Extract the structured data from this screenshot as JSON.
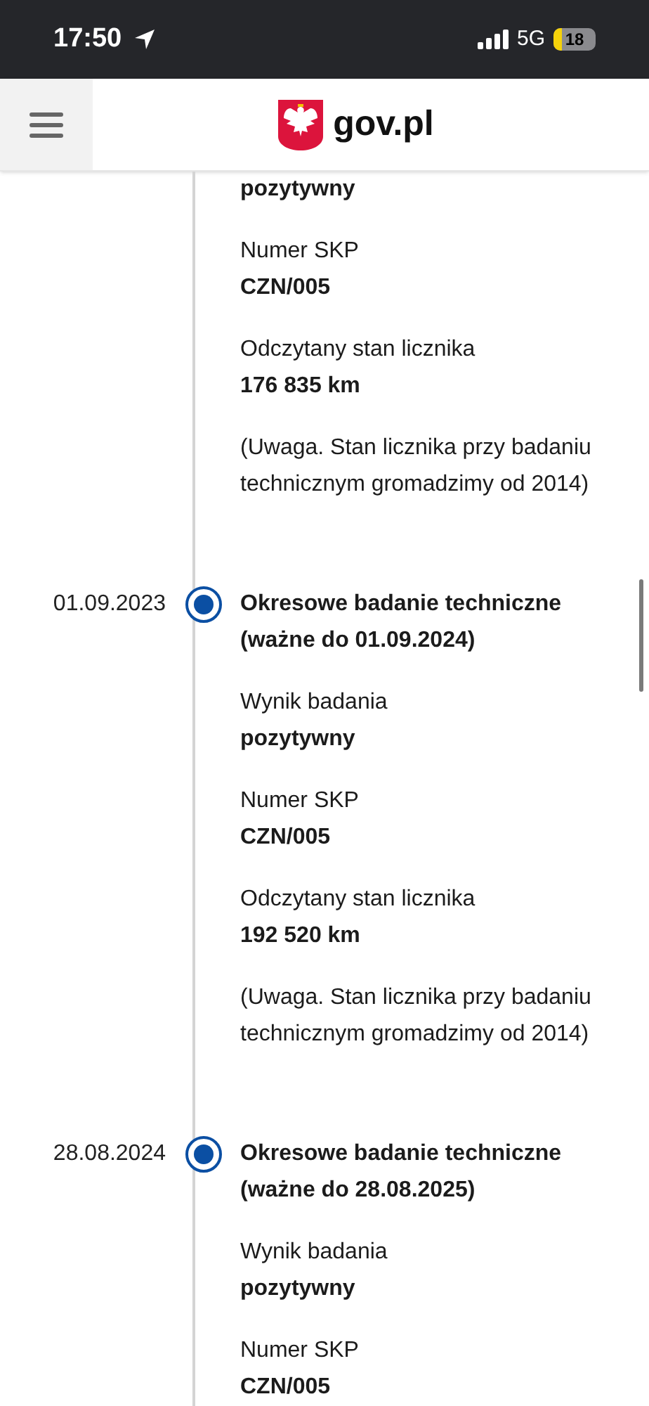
{
  "status_bar": {
    "time": "17:50",
    "network": "5G",
    "battery": "18"
  },
  "header": {
    "logo_text": "gov.pl"
  },
  "entries": [
    {
      "fields": [
        {
          "value": "pozytywny"
        },
        {
          "label": "Numer SKP",
          "value": "CZN/005"
        },
        {
          "label": "Odczytany stan licznika",
          "value": "176 835 km"
        }
      ],
      "note": "(Uwaga. Stan licznika przy badaniu technicznym gromadzimy od 2014)"
    },
    {
      "date": "01.09.2023",
      "title": "Okresowe badanie techniczne (ważne do 01.09.2024)",
      "fields": [
        {
          "label": "Wynik badania",
          "value": "pozytywny"
        },
        {
          "label": "Numer SKP",
          "value": "CZN/005"
        },
        {
          "label": "Odczytany stan licznika",
          "value": "192 520 km"
        }
      ],
      "note": "(Uwaga. Stan licznika przy badaniu technicznym gromadzimy od 2014)"
    },
    {
      "date": "28.08.2024",
      "title": "Okresowe badanie techniczne (ważne do 28.08.2025)",
      "fields": [
        {
          "label": "Wynik badania",
          "value": "pozytywny"
        },
        {
          "label": "Numer SKP",
          "value": "CZN/005"
        }
      ]
    }
  ]
}
